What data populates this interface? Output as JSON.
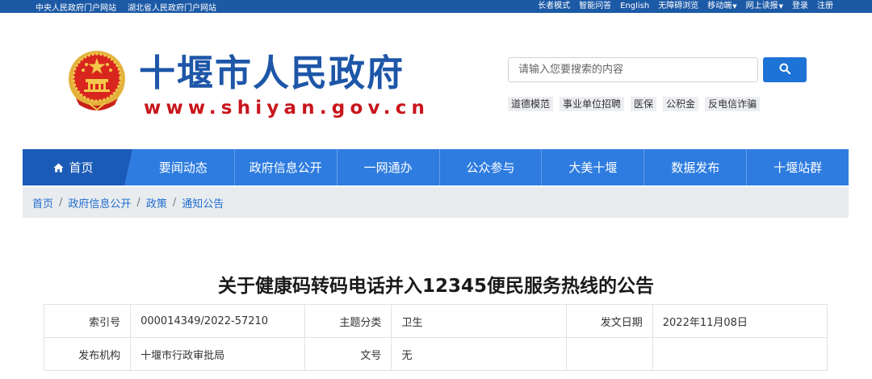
{
  "topbar": {
    "left_links": [
      "中央人民政府门户网站",
      "湖北省人民政府门户网站"
    ],
    "right_links": [
      {
        "label": "长者模式",
        "dropdown": false
      },
      {
        "label": "智能问答",
        "dropdown": false
      },
      {
        "label": "English",
        "dropdown": false
      },
      {
        "label": "无障碍浏览",
        "dropdown": false
      },
      {
        "label": "移动端",
        "dropdown": true
      },
      {
        "label": "网上读报",
        "dropdown": true
      },
      {
        "label": "登录",
        "dropdown": false
      },
      {
        "label": "注册",
        "dropdown": false
      }
    ]
  },
  "header": {
    "site_title": "十堰市人民政府",
    "site_url": "www.shiyan.gov.cn"
  },
  "search": {
    "placeholder": "请输入您要搜索的内容",
    "value": "",
    "hotwords": [
      "道德模范",
      "事业单位招聘",
      "医保",
      "公积金",
      "反电信诈骗"
    ]
  },
  "nav": {
    "home_label": "首页",
    "items": [
      "要闻动态",
      "政府信息公开",
      "一网通办",
      "公众参与",
      "大美十堰",
      "数据发布",
      "十堰站群"
    ]
  },
  "breadcrumb": [
    "首页",
    "政府信息公开",
    "政策",
    "通知公告"
  ],
  "article": {
    "title": "关于健康码转码电话并入12345便民服务热线的公告",
    "meta": {
      "index_no_label": "索引号",
      "index_no": "000014349/2022-57210",
      "topic_label": "主题分类",
      "topic": "卫生",
      "date_label": "发文日期",
      "date": "2022年11月08日",
      "issuer_label": "发布机构",
      "issuer": "十堰市行政审批局",
      "doc_no_label": "文号",
      "doc_no": "无"
    }
  },
  "colors": {
    "topbar": "#1c5aa6",
    "nav": "#2e7ce0",
    "nav_home": "#1b5bb8",
    "title_blue": "#1e56a8",
    "url_red": "#c8151b",
    "link": "#1e6ccf"
  }
}
